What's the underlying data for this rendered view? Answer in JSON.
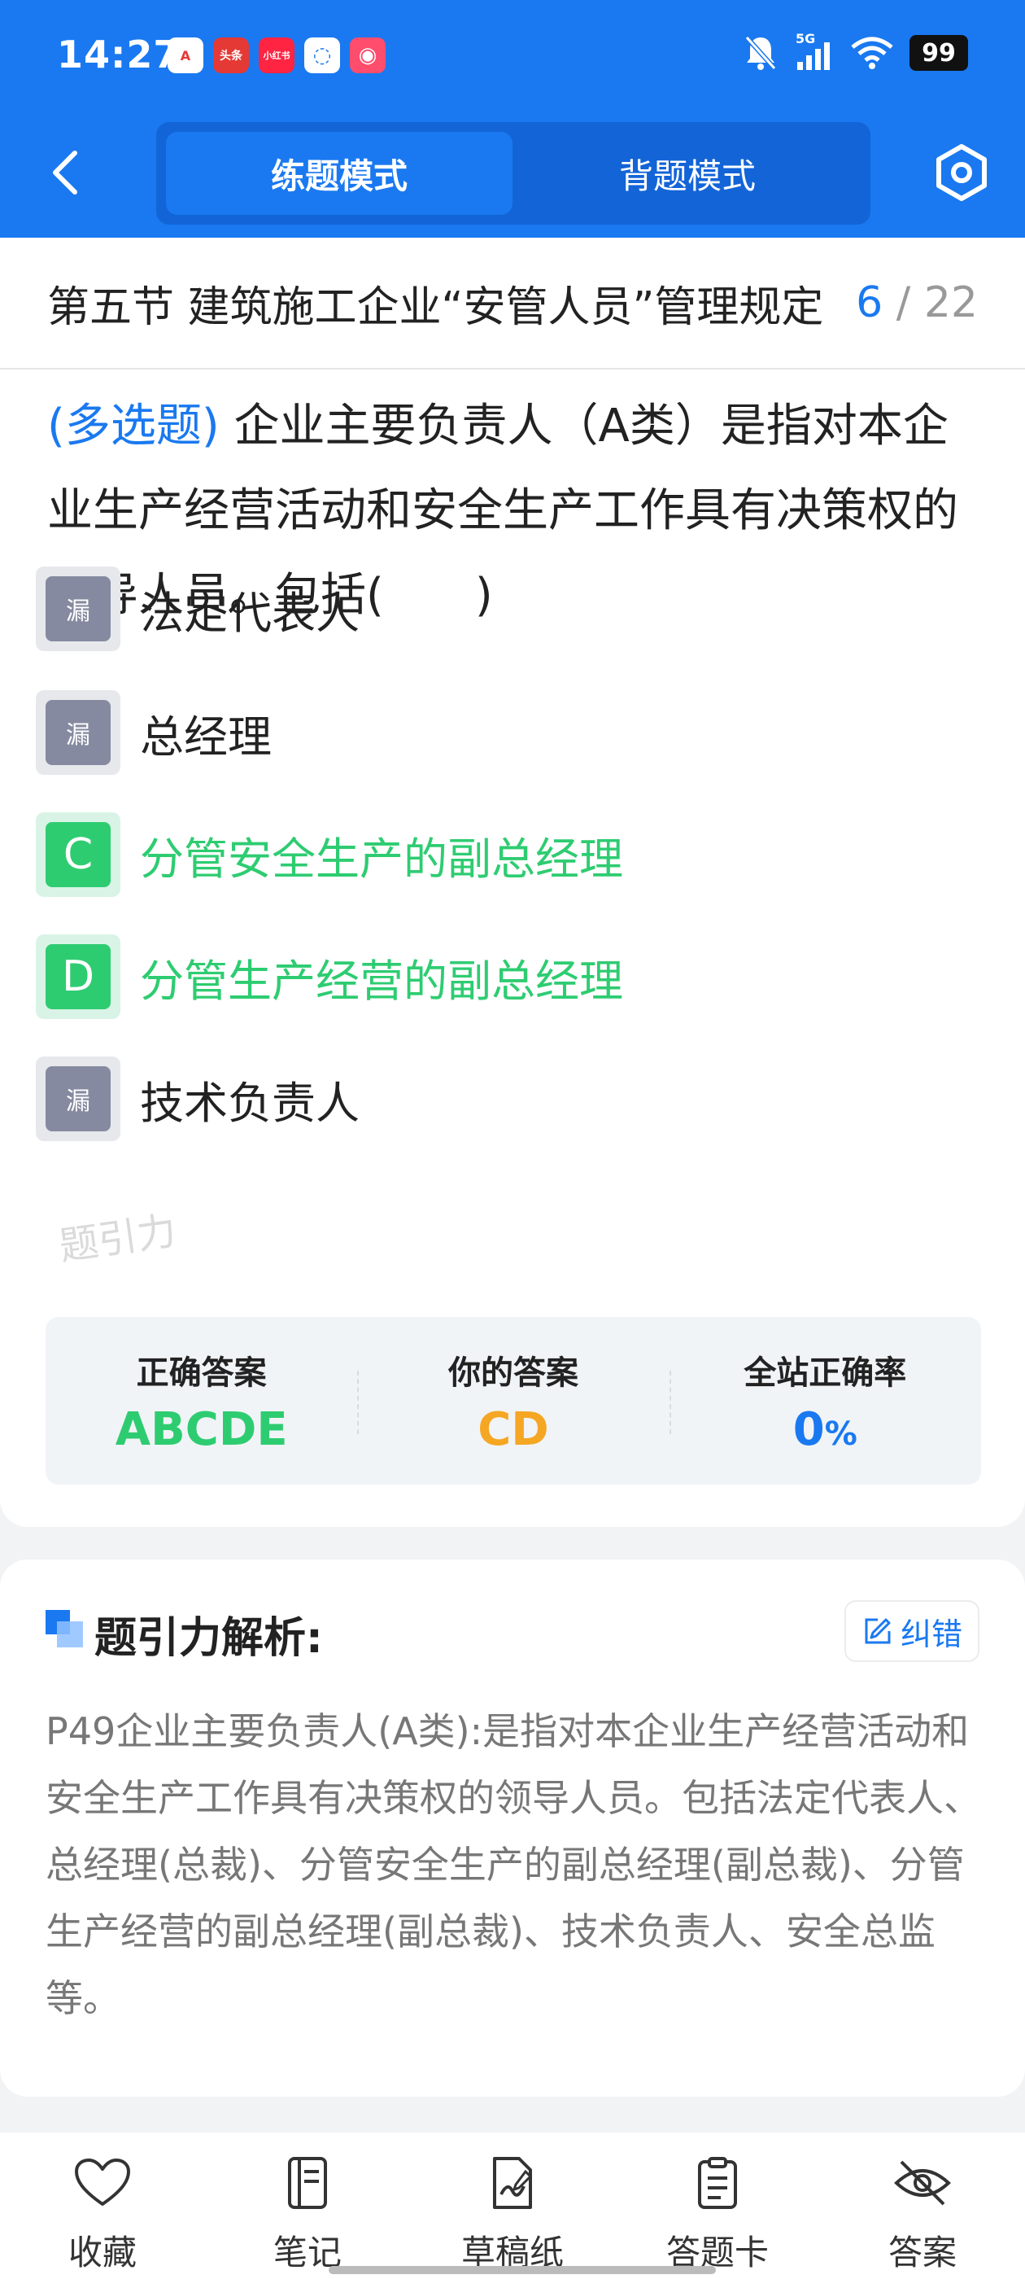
{
  "status_bar": {
    "time": "14:27",
    "apps": [
      {
        "name": "app-a-icon",
        "label": "A",
        "bg": "#fff",
        "color": "#e53935"
      },
      {
        "name": "toutiao-icon",
        "label": "头条",
        "bg": "#e53935",
        "color": "#fff"
      },
      {
        "name": "xiaohongshu-icon",
        "label": "小红书",
        "bg": "#ff2442",
        "color": "#fff"
      },
      {
        "name": "chat-app-icon",
        "label": "◌",
        "bg": "#fff",
        "color": "#1a79f0"
      },
      {
        "name": "mail-app-icon",
        "label": "◉",
        "bg": "#ff4d6d",
        "color": "#fff"
      }
    ],
    "network": "5G",
    "battery": "99"
  },
  "nav": {
    "tabs": [
      {
        "label": "练题模式",
        "active": true
      },
      {
        "label": "背题模式",
        "active": false
      }
    ]
  },
  "question_card": {
    "section_title": "第五节 建筑施工企业“安管人员”管理规定",
    "current": "6",
    "separator": "/",
    "total": "22",
    "question_type": "(多选题)",
    "question_text": "企业主要负责人（A类）是指对本企业生产经营活动和安全生产工作具有决策权的领导人员。包括(　　)",
    "options": [
      {
        "badge": "漏",
        "text": "法定代表人",
        "state": "missed"
      },
      {
        "badge": "漏",
        "text": "总经理",
        "state": "missed"
      },
      {
        "badge": "C",
        "text": "分管安全生产的副总经理",
        "state": "correct"
      },
      {
        "badge": "D",
        "text": "分管生产经营的副总经理",
        "state": "correct"
      },
      {
        "badge": "漏",
        "text": "技术负责人",
        "state": "missed"
      }
    ],
    "watermark": "题引力",
    "stats": {
      "correct_label": "正确答案",
      "correct_value": "ABCDE",
      "yours_label": "你的答案",
      "yours_value": "CD",
      "rate_label": "全站正确率",
      "rate_value": "0",
      "rate_unit": "%"
    }
  },
  "analysis": {
    "title": "题引力解析:",
    "report_label": "纠错",
    "body": "P49企业主要负责人(A类):是指对本企业生产经营活动和安全生产工作具有决策权的领导人员。包括法定代表人、总经理(总裁)、分管安全生产的副总经理(副总裁)、分管生产经营的副总经理(副总裁)、技术负责人、安全总监等。"
  },
  "bottom_bar": {
    "items": [
      {
        "label": "收藏",
        "icon": "heart-icon"
      },
      {
        "label": "笔记",
        "icon": "notebook-icon"
      },
      {
        "label": "草稿纸",
        "icon": "draft-paper-icon"
      },
      {
        "label": "答题卡",
        "icon": "answer-card-icon"
      },
      {
        "label": "答案",
        "icon": "eye-off-icon"
      }
    ]
  },
  "colors": {
    "primary": "#1a79f0",
    "correct": "#2ecc71",
    "user_answer": "#f5a623",
    "missed_badge": "#868aa0"
  }
}
